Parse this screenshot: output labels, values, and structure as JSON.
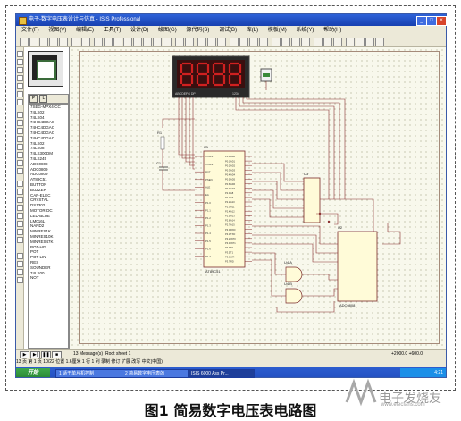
{
  "window": {
    "title": "电子-数字电压表设计与仿真 - ISIS Professional"
  },
  "menu": [
    "文件(F)",
    "视图(V)",
    "编辑(E)",
    "工具(T)",
    "设计(D)",
    "绘图(G)",
    "源代码(S)",
    "调试(B)",
    "库(L)",
    "模板(M)",
    "系统(Y)",
    "帮助(H)"
  ],
  "panel": {
    "mode_buttons": [
      "P",
      "L"
    ],
    "devices": [
      "7SEG-MPX4-CC",
      "74LS02",
      "74LS04",
      "74HC4DGAC",
      "74HC4DGAC",
      "74HC4DGAC",
      "74HC4DGAC",
      "74LS02",
      "74LS08",
      "74LS300DM",
      "74LS245",
      "ADC0808",
      "ADC0809",
      "ADC0809",
      "AT89C51",
      "BUTTON",
      "BUZZER",
      "CAP-ELEC",
      "CRYSTAL",
      "DS1302",
      "MOTOR-DC",
      "LED-BLUE",
      "LM016L",
      "NAND2",
      "MINRES1K",
      "MINRES10K",
      "MINRES47K",
      "POT-HG",
      "POT",
      "POT-LIN",
      "RES",
      "SOUNDER",
      "74LS00",
      "NOT"
    ]
  },
  "schematic": {
    "display_label": "8888",
    "lcd_label": "ABCDEFG DP",
    "digit_pins": "1234",
    "u1_label": "U1",
    "u1_part": "AT89C51",
    "u2_label": "U2",
    "u2_part": "ADC0808",
    "u3_label": "U3",
    "u4_label": "U4:A",
    "u5_label": "U4:B",
    "r_label": "R1",
    "c_label": "C1",
    "u1_pins_left": [
      "XTAL1",
      "XTAL2",
      "RST",
      "PSEN",
      "ALE",
      "EA",
      "P1.0",
      "P1.1",
      "P1.2",
      "P1.3",
      "P1.4",
      "P1.5",
      "P1.6",
      "P1.7"
    ],
    "u1_pins_right": [
      "P0.0/AD0",
      "P0.1/AD1",
      "P0.2/AD2",
      "P0.3/AD3",
      "P0.4/AD4",
      "P0.5/AD5",
      "P0.6/AD6",
      "P0.7/AD7",
      "P2.0/A8",
      "P2.1/A9",
      "P2.2/A10",
      "P2.3/A11",
      "P2.4/A12",
      "P2.5/A13",
      "P2.6/A14",
      "P2.7/A15",
      "P3.0/RXD",
      "P3.1/TXD",
      "P3.2/INT0",
      "P3.3/INT1",
      "P3.4/T0",
      "P3.5/T1",
      "P3.6/WR",
      "P3.7/RD"
    ]
  },
  "status": {
    "message_count": "13 Message(s)",
    "sheet": "Root sheet 1",
    "coords": "+2000.0  +600.0"
  },
  "taskbar": {
    "start": "开始",
    "upper": "13 页  第 1 页  10/22  位置 1.6厘米  1 行  1 列  录制  修订  扩展  改写  中文(中国)",
    "items": [
      "1 适于单片机控制",
      "2 简易数字电压表的",
      "ISIS 6000 Ass Pr..."
    ],
    "clock": "4:21"
  },
  "caption": "图1 简易数字电压表电路图",
  "watermark": {
    "text": "电子发烧友",
    "url": "www.elecfans.com"
  },
  "colors": {
    "title_bar": "#2e62d8",
    "display_segments": "#d02020",
    "wire": "#8a3030",
    "canvas": "#f8f8ec"
  }
}
